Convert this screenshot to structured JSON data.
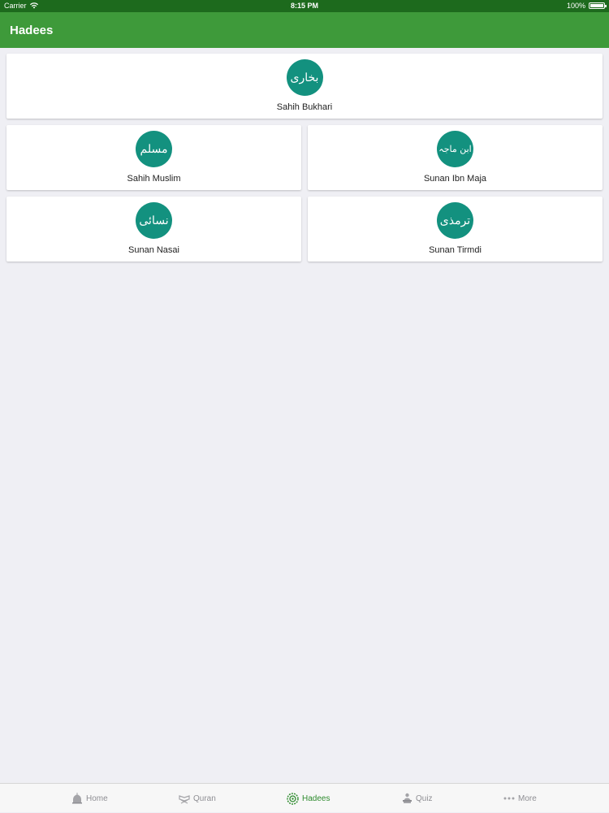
{
  "status_bar": {
    "carrier": "Carrier",
    "time": "8:15 PM",
    "battery": "100%"
  },
  "navbar": {
    "title": "Hadees"
  },
  "books": [
    {
      "name": "Sahih Bukhari",
      "emblem_text": "بخاری"
    },
    {
      "name": "Sahih Muslim",
      "emblem_text": "مسلم"
    },
    {
      "name": "Sunan Ibn Maja",
      "emblem_text": "ابن ماجہ"
    },
    {
      "name": "Sunan Nasai",
      "emblem_text": "نسائی"
    },
    {
      "name": "Sunan Tirmdi",
      "emblem_text": "ترمذی"
    }
  ],
  "tabbar": {
    "tabs": [
      {
        "label": "Home",
        "icon": "mosque-icon"
      },
      {
        "label": "Quran",
        "icon": "quran-stand-icon"
      },
      {
        "label": "Hadees",
        "icon": "hadees-emblem-icon"
      },
      {
        "label": "Quiz",
        "icon": "person-reading-icon"
      },
      {
        "label": "More",
        "icon": "more-dots-icon"
      }
    ],
    "active": "Hadees"
  },
  "colors": {
    "navbar": "#3e9a3a",
    "status_bar": "#1d6a1d",
    "emblem": "#13917f",
    "active_tab": "#2e8b2e"
  }
}
